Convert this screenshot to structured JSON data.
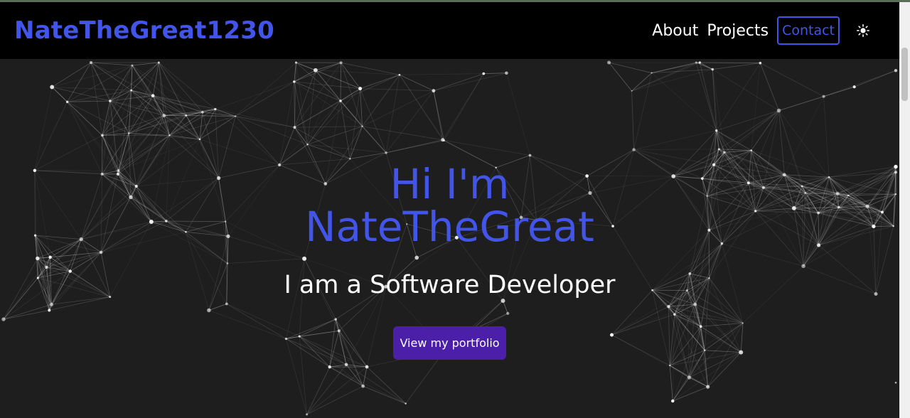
{
  "navbar": {
    "brand": "NateTheGreat1230",
    "links": [
      "About",
      "Projects"
    ],
    "contact_label": "Contact",
    "theme_icon": "sun-icon"
  },
  "hero": {
    "title_line1": "Hi I'm",
    "title_line2": "NateTheGreat",
    "subtitle": "I am a Software Developer",
    "cta_label": "View my portfolio",
    "background": "particle-network"
  },
  "colors": {
    "accent": "#4255e8",
    "button": "#4b1fa8",
    "navbar_bg": "#000000",
    "hero_bg": "#1e1e1e"
  }
}
